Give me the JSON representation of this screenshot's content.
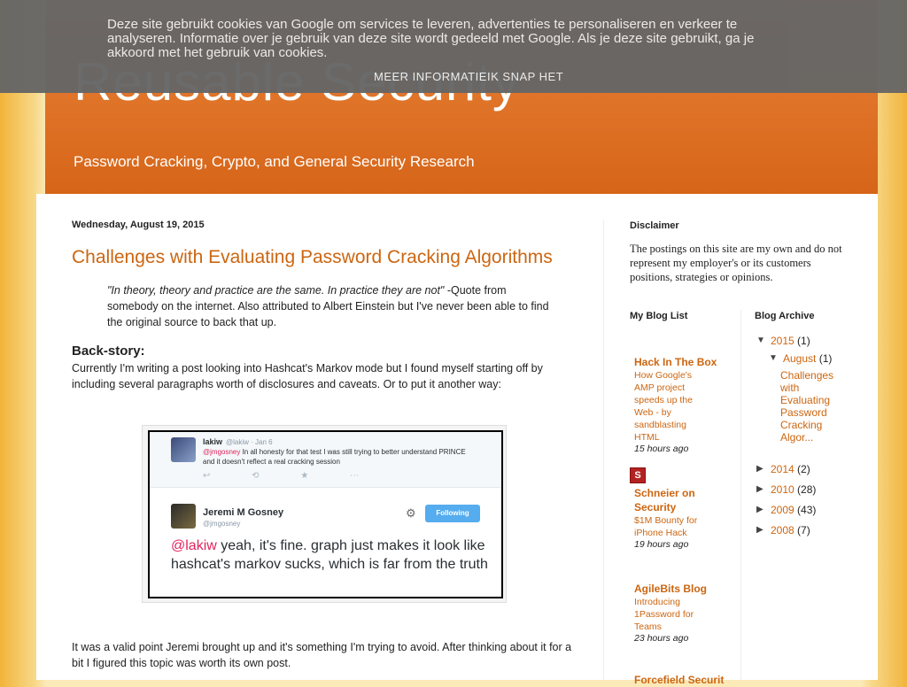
{
  "cookie_banner": {
    "text": "Deze site gebruikt cookies van Google om services te leveren, advertenties te personaliseren en verkeer te analyseren. Informatie over je gebruik van deze site wordt gedeeld met Google. Als je deze site gebruikt, ga je akkoord met het gebruik van cookies.",
    "more_info_label": "MEER INFORMATIE",
    "accept_label": "IK SNAP HET"
  },
  "header": {
    "title": "Reusable Security",
    "description": "Password Cracking, Crypto, and General Security Research"
  },
  "post": {
    "date": "Wednesday, August 19, 2015",
    "title": "Challenges with Evaluating Password Cracking Algorithms",
    "quote_italic": "\"In theory, theory and practice are the same. In practice they are not\"",
    "quote_rest": " -Quote from somebody on the internet. Also attributed to Albert Einstein but I've never been able to find the original source to back that up.",
    "backstory_heading": "Back-story:",
    "backstory_text": "Currently I'm writing a post looking into Hashcat's Markov mode but I found myself starting off by including several paragraphs worth of disclosures and caveats. Or to put it another way:",
    "after_text": "It was a valid point Jeremi brought up and it's something I'm trying to avoid. After thinking about it for a bit I figured this topic was worth its own post."
  },
  "tweet": {
    "reply_name": "lakiw",
    "reply_handle": "@lakiw · Jan 6",
    "reply_mention": "@jmgosney",
    "reply_text": " In all honesty for that test I was still trying to better understand PRINCE and it doesn't reflect a real cracking session",
    "actions": "↩ ⟲ ★ ⋯",
    "main_name": "Jeremi M Gosney",
    "main_handle": "@jmgosney",
    "follow_label": "Following",
    "main_mention": "@lakiw",
    "main_text": " yeah, it's fine. graph just makes it look like hashcat's markov sucks, which is far from the truth"
  },
  "sidebar": {
    "disclaimer_heading": "Disclaimer",
    "disclaimer_text": "The postings on this site are my own and do not represent my employer's or its customers positions, strategies or opinions.",
    "blog_list_heading": "My Blog List",
    "blog_list": [
      {
        "title": "Hack In The Box",
        "post": "How Google's AMP project speeds up the Web - by sandblasting HTML",
        "time": "15 hours ago"
      },
      {
        "title": "Schneier on Security",
        "post": "$1M Bounty for iPhone Hack",
        "time": "19 hours ago",
        "icon": "S"
      },
      {
        "title": "AgileBits Blog",
        "post": "Introducing 1Password for Teams",
        "time": "23 hours ago"
      },
      {
        "title": "Forcefield Securit"
      }
    ],
    "archive_heading": "Blog Archive",
    "archive": {
      "year_open": "2015",
      "year_open_count": "(1)",
      "month_open": "August",
      "month_open_count": "(1)",
      "post_link": "Challenges with Evaluating Password Cracking Algor...",
      "years": [
        {
          "year": "2014",
          "count": "(2)"
        },
        {
          "year": "2010",
          "count": "(28)"
        },
        {
          "year": "2009",
          "count": "(43)"
        },
        {
          "year": "2008",
          "count": "(7)"
        }
      ]
    }
  }
}
